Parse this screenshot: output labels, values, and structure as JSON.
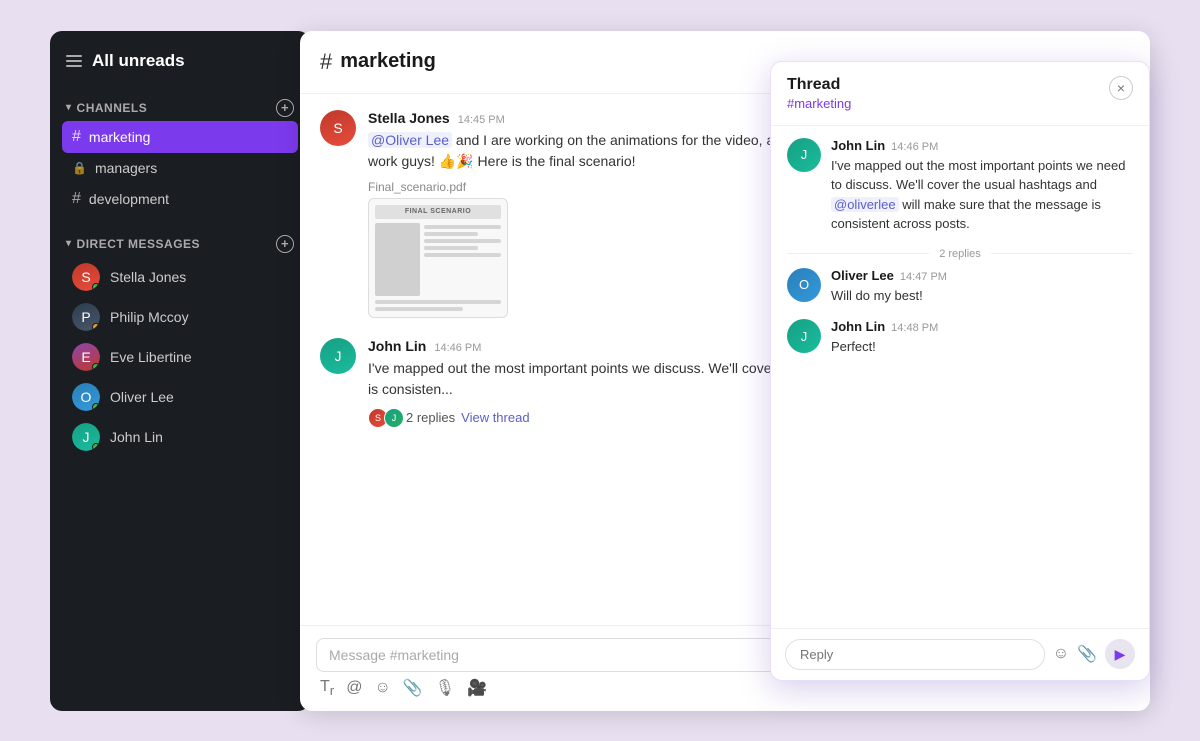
{
  "sidebar": {
    "title": "All unreads",
    "channels_section": "CHANNELS",
    "direct_messages_section": "DIRECT MESSAGES",
    "channels": [
      {
        "id": "marketing",
        "name": "marketing",
        "type": "hash",
        "active": true
      },
      {
        "id": "managers",
        "name": "managers",
        "type": "lock",
        "active": false
      },
      {
        "id": "development",
        "name": "development",
        "type": "hash",
        "active": false
      }
    ],
    "direct_messages": [
      {
        "id": "stella",
        "name": "Stella Jones",
        "status": "online"
      },
      {
        "id": "philip",
        "name": "Philip Mccoy",
        "status": "away"
      },
      {
        "id": "eve",
        "name": "Eve Libertine",
        "status": "online"
      },
      {
        "id": "oliver",
        "name": "Oliver Lee",
        "status": "online"
      },
      {
        "id": "john",
        "name": "John Lin",
        "status": "online"
      }
    ]
  },
  "chat": {
    "channel_name": "marketing",
    "messages": [
      {
        "id": "msg1",
        "author": "Stella Jones",
        "time": "14:45 PM",
        "text_parts": [
          {
            "type": "mention",
            "text": "@Oliver Lee"
          },
          {
            "type": "text",
            "text": " and I are working on the animations for the video, and we are planning to finish it within two days. Great work guys! 👍🎉 Here is the final scenario!"
          }
        ],
        "attachment": {
          "filename": "Final_scenario.pdf",
          "type": "pdf"
        },
        "avatar_class": "face-stella"
      },
      {
        "id": "msg2",
        "author": "John Lin",
        "time": "14:46 PM",
        "text": "I've mapped out the most important points we discuss. We'll cover the usual hashtags and will make sure that the message is consisten...",
        "avatar_class": "face-john",
        "replies": {
          "count": "2 replies",
          "link": "View thread"
        }
      }
    ],
    "input_placeholder": "Message #marketing",
    "toolbar": {
      "format": "Tr",
      "mention": "@",
      "emoji": "☺",
      "attach": "📎",
      "audio": "🎤",
      "video": "📷"
    }
  },
  "thread": {
    "title": "Thread",
    "channel": "#marketing",
    "close_label": "×",
    "messages": [
      {
        "id": "tm1",
        "author": "John Lin",
        "time": "14:46 PM",
        "text_parts": [
          {
            "type": "text",
            "text": "I've mapped out the most important points we need to discuss. We'll cover the usual hashtags and "
          },
          {
            "type": "mention",
            "text": "@oliverlee"
          },
          {
            "type": "text",
            "text": " will make sure that the message is consistent across posts."
          }
        ],
        "avatar_class": "face-john"
      },
      {
        "id": "tm-divider",
        "replies_label": "2 replies"
      },
      {
        "id": "tm2",
        "author": "Oliver Lee",
        "time": "14:47 PM",
        "text": "Will do my best!",
        "avatar_class": "face-oliver"
      },
      {
        "id": "tm3",
        "author": "John Lin",
        "time": "14:48 PM",
        "text": "Perfect!",
        "avatar_class": "face-john"
      }
    ],
    "input_placeholder": "Reply"
  },
  "icons": {
    "hash": "#",
    "lock": "🔒",
    "chevron_down": "▾",
    "add": "+",
    "send": "▶",
    "emoji_smile": "☺",
    "paperclip": "📎",
    "mic": "🎙",
    "video_cam": "🎥"
  }
}
